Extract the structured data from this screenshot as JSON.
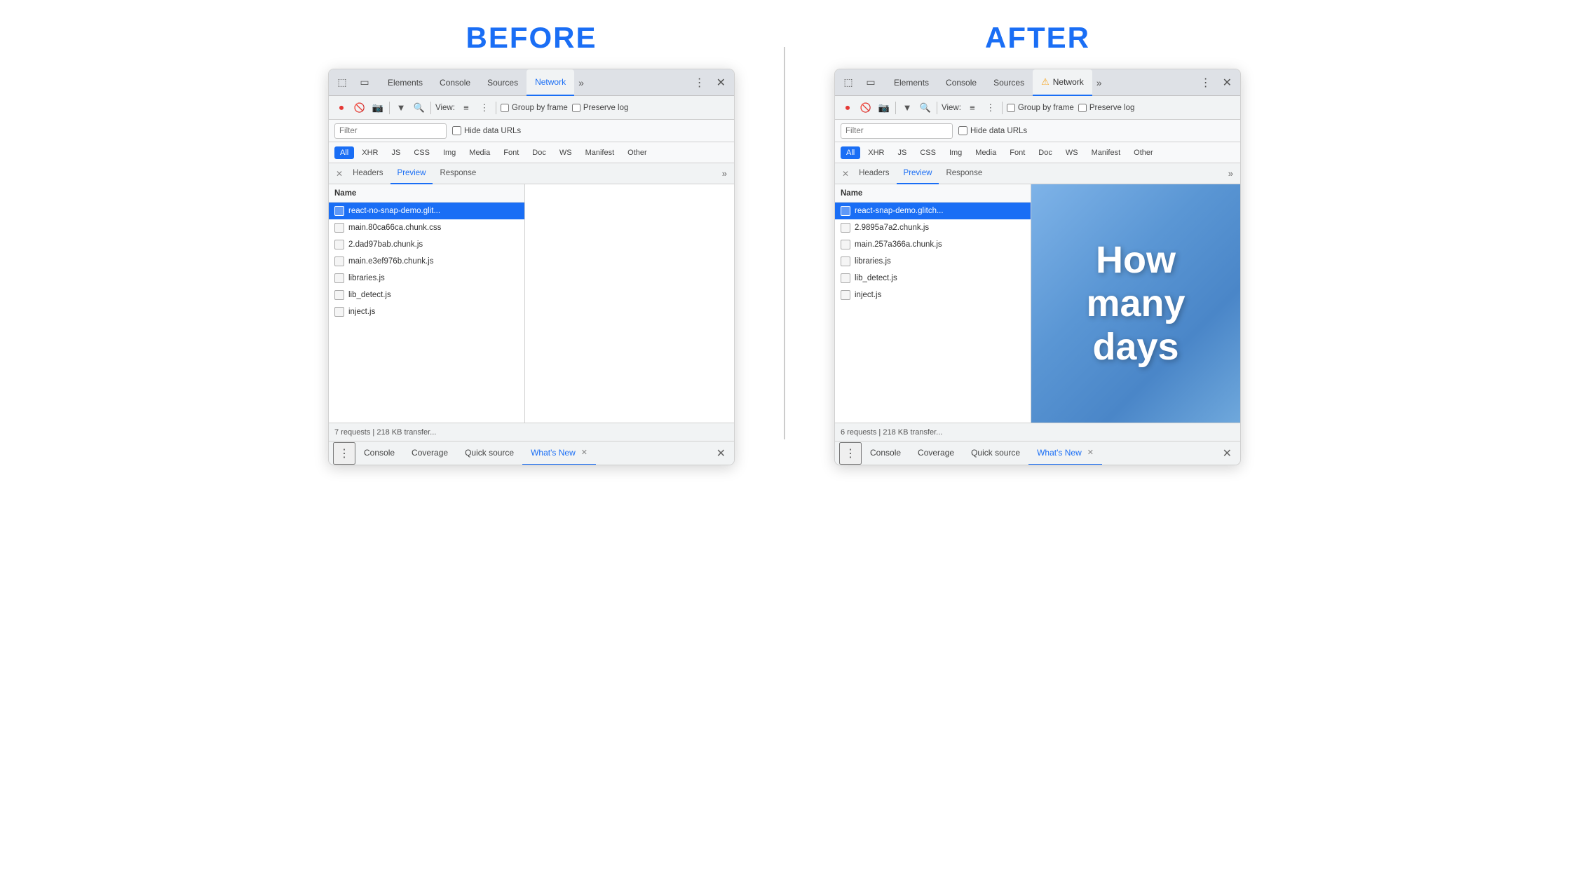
{
  "before": {
    "label": "BEFORE",
    "tabs": [
      "Elements",
      "Console",
      "Sources",
      "Network",
      ">>"
    ],
    "active_tab": "Network",
    "toolbar": {
      "view_label": "View:",
      "group_by_frame": "Group by frame",
      "preserve_log": "Preserve log"
    },
    "filter_placeholder": "Filter",
    "hide_data_urls": "Hide data URLs",
    "filter_types": [
      "All",
      "XHR",
      "JS",
      "CSS",
      "Img",
      "Media",
      "Font",
      "Doc",
      "WS",
      "Manifest",
      "Other"
    ],
    "active_filter": "All",
    "panel_tabs": [
      "Name",
      "Headers",
      "Preview",
      "Response",
      ">>"
    ],
    "active_panel_tab": "Preview",
    "files": [
      {
        "name": "react-no-snap-demo.glit...",
        "selected": true
      },
      {
        "name": "main.80ca66ca.chunk.css",
        "selected": false
      },
      {
        "name": "2.dad97bab.chunk.js",
        "selected": false
      },
      {
        "name": "main.e3ef976b.chunk.js",
        "selected": false
      },
      {
        "name": "libraries.js",
        "selected": false
      },
      {
        "name": "lib_detect.js",
        "selected": false
      },
      {
        "name": "inject.js",
        "selected": false
      }
    ],
    "status": "7 requests | 218 KB transfer...",
    "bottom_tabs": [
      "Console",
      "Coverage",
      "Quick source",
      "What's New"
    ],
    "active_bottom_tab": "What's New",
    "preview_content": "empty"
  },
  "after": {
    "label": "AFTER",
    "tabs": [
      "Elements",
      "Console",
      "Sources",
      "Network",
      ">>"
    ],
    "active_tab": "Network",
    "has_warning": true,
    "toolbar": {
      "view_label": "View:",
      "group_by_frame": "Group by frame",
      "preserve_log": "Preserve log"
    },
    "filter_placeholder": "Filter",
    "hide_data_urls": "Hide data URLs",
    "filter_types": [
      "All",
      "XHR",
      "JS",
      "CSS",
      "Img",
      "Media",
      "Font",
      "Doc",
      "WS",
      "Manifest",
      "Other"
    ],
    "active_filter": "All",
    "panel_tabs": [
      "Name",
      "Headers",
      "Preview",
      "Response",
      ">>"
    ],
    "active_panel_tab": "Preview",
    "files": [
      {
        "name": "react-snap-demo.glitch...",
        "selected": true
      },
      {
        "name": "2.9895a7a2.chunk.js",
        "selected": false
      },
      {
        "name": "main.257a366a.chunk.js",
        "selected": false
      },
      {
        "name": "libraries.js",
        "selected": false
      },
      {
        "name": "lib_detect.js",
        "selected": false
      },
      {
        "name": "inject.js",
        "selected": false
      }
    ],
    "status": "6 requests | 218 KB transfer...",
    "bottom_tabs": [
      "Console",
      "Coverage",
      "Quick source",
      "What's New"
    ],
    "active_bottom_tab": "What's New",
    "preview_content": "How many days",
    "preview_lines": [
      "How",
      "many",
      "days"
    ]
  },
  "icons": {
    "record": "⏺",
    "stop": "🚫",
    "camera": "📷",
    "filter": "▼",
    "search": "🔍",
    "list": "≡",
    "tree": "⋮",
    "more": "»",
    "close": "✕",
    "more_vert": "⋮",
    "warning": "⚠"
  }
}
